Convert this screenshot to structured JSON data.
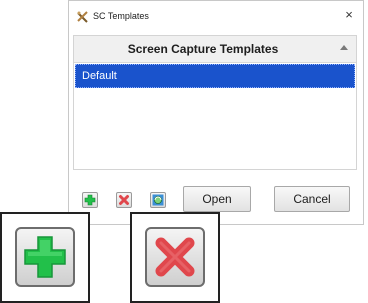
{
  "window": {
    "title": "SC Templates",
    "close_glyph": "×",
    "app_icon": "sc-templates-icon"
  },
  "list": {
    "header": "Screen Capture Templates",
    "sort_indicator": "ascending",
    "items": [
      {
        "label": "Default",
        "selected": true
      }
    ]
  },
  "toolbar": {
    "add_icon": "plus-icon",
    "delete_icon": "x-icon",
    "import_icon": "globe-refresh-icon",
    "open_label": "Open",
    "cancel_label": "Cancel"
  },
  "zoomed_callouts": [
    {
      "icon": "plus-icon",
      "color": "#22c04a"
    },
    {
      "icon": "x-icon",
      "color": "#e0474c"
    }
  ],
  "colors": {
    "selection": "#1a53cc",
    "add_green": "#22c04a",
    "delete_red": "#e0474c"
  }
}
